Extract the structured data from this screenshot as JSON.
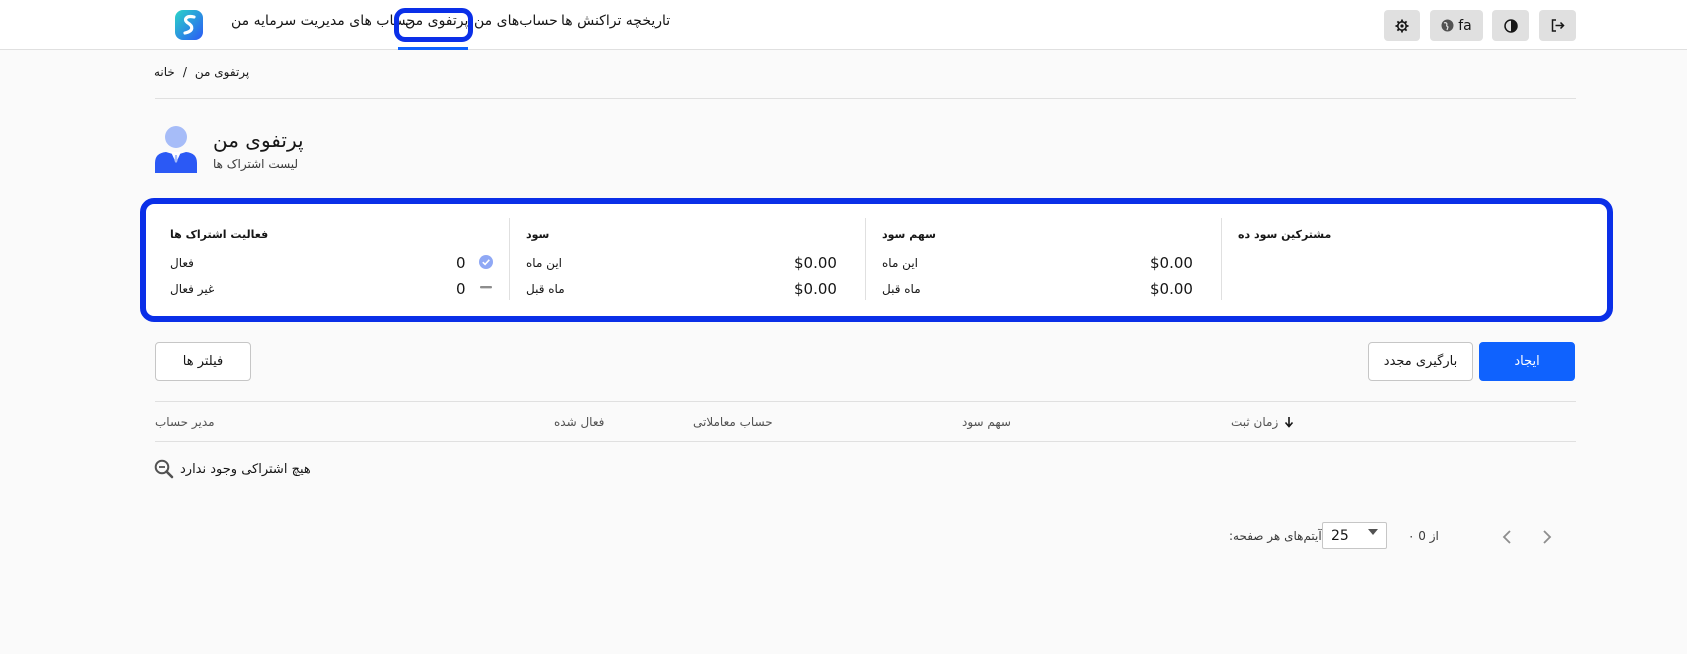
{
  "header": {
    "nav": [
      {
        "label": "تاریخچه تراکنش ها"
      },
      {
        "label": "حساب‌های من"
      },
      {
        "label": "پرتفوی من",
        "active": true
      },
      {
        "label": "حساب های مدیریت سرمایه من"
      }
    ],
    "language_label": "fa",
    "accent_color": "#0f62fe",
    "highlight_color": "#0a2fe8",
    "icons": [
      "settings-gear-icon",
      "globe-icon",
      "theme-contrast-icon",
      "logout-icon"
    ]
  },
  "breadcrumb": {
    "items": [
      "خانه",
      "پرتفوی من"
    ],
    "separator": "/"
  },
  "page": {
    "title": "پرتفوی من",
    "subtitle": "لیست اشتراک ها"
  },
  "stats": {
    "activity": {
      "title": "فعالیت اشتراک ها",
      "active_label": "فعال",
      "active_count": "0",
      "inactive_label": "غیر فعال",
      "inactive_count": "0"
    },
    "profit": {
      "title": "سود",
      "this_month_label": "این ماه",
      "this_month_value": "$0.00",
      "last_month_label": "ماه قبل",
      "last_month_value": "$0.00"
    },
    "profit_share": {
      "title": "سهم سود",
      "this_month_label": "این ماه",
      "this_month_value": "$0.00",
      "last_month_label": "ماه قبل",
      "last_month_value": "$0.00"
    },
    "subscribers": {
      "title": "مشترکین سود ده"
    }
  },
  "actions": {
    "filters_label": "فیلتر ها",
    "reload_label": "بارگیری مجدد",
    "create_label": "ایجاد"
  },
  "table": {
    "columns": [
      "مدیر حساب",
      "فعال شده",
      "حساب معاملاتی",
      "سهم سود",
      "زمان ثبت"
    ],
    "empty_message": "هیچ اشتراکی وجود ندارد"
  },
  "pagination": {
    "items_per_page_label": ":آیتم‌های هر صفحه",
    "page_size": "25",
    "range_text": "از 0 ۰"
  }
}
